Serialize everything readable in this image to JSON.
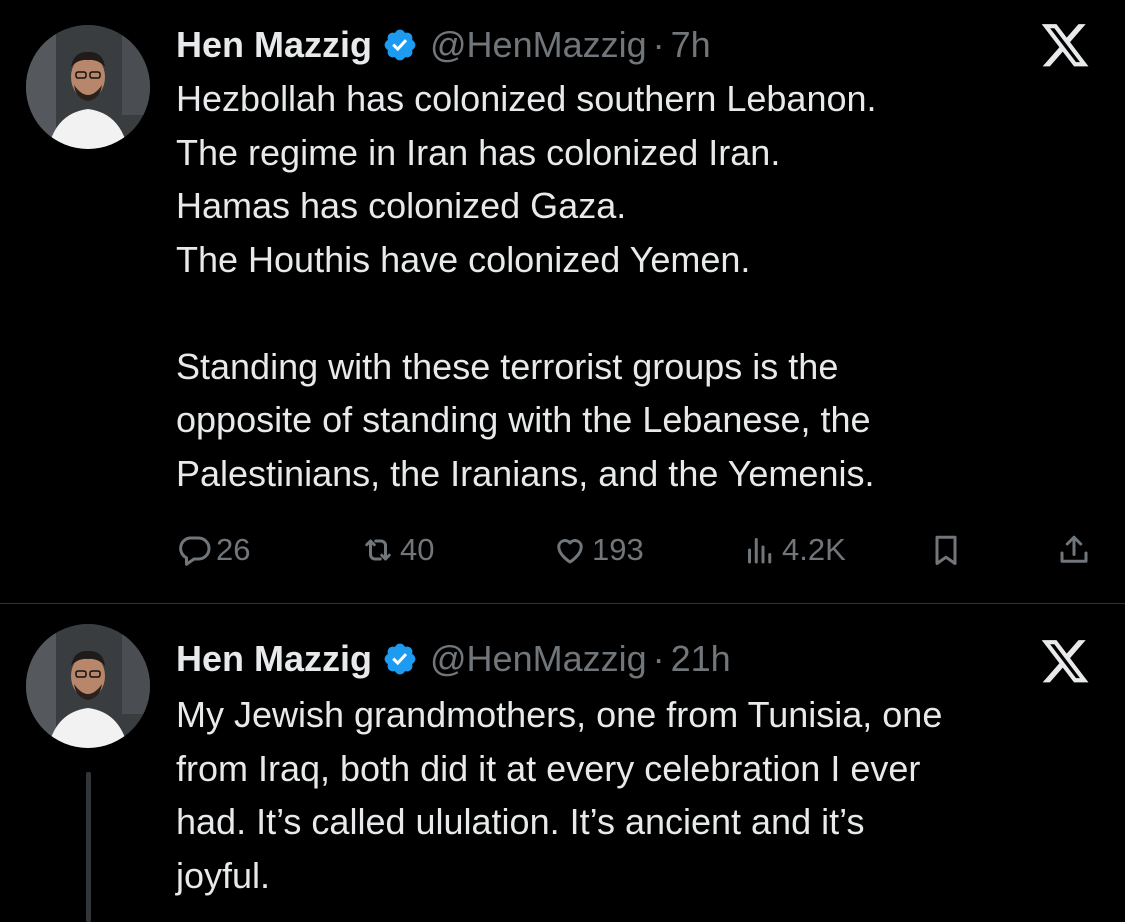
{
  "tweets": [
    {
      "author_name": "Hen Mazzig",
      "handle": "@HenMazzig",
      "separator": "·",
      "time": "7h",
      "lines": [
        "Hezbollah has colonized southern Lebanon.",
        "The regime in Iran has colonized Iran.",
        "Hamas has colonized Gaza.",
        "The Houthis have colonized Yemen.",
        "",
        "Standing with these terrorist groups is the",
        "opposite of standing with the Lebanese, the",
        "Palestinians, the Iranians, and the Yemenis."
      ],
      "stats": {
        "replies": "26",
        "reposts": "40",
        "likes": "193",
        "views": "4.2K"
      }
    },
    {
      "author_name": "Hen Mazzig",
      "handle": "@HenMazzig",
      "separator": "·",
      "time": "21h",
      "lines": [
        "My Jewish grandmothers, one from Tunisia, one",
        "from Iraq, both did it at every celebration I ever",
        "had. It’s called ululation. It’s ancient and it’s",
        "joyful."
      ]
    }
  ],
  "icons": {
    "verified": "verified-badge-icon",
    "platform": "x-logo-icon",
    "reply": "reply-icon",
    "repost": "repost-icon",
    "like": "heart-icon",
    "views": "views-icon",
    "bookmark": "bookmark-icon",
    "share": "share-icon"
  },
  "colors": {
    "background": "#000000",
    "text": "#e7e9ea",
    "secondary": "#71767b",
    "verified": "#1d9bf0",
    "divider": "#2f3336"
  }
}
